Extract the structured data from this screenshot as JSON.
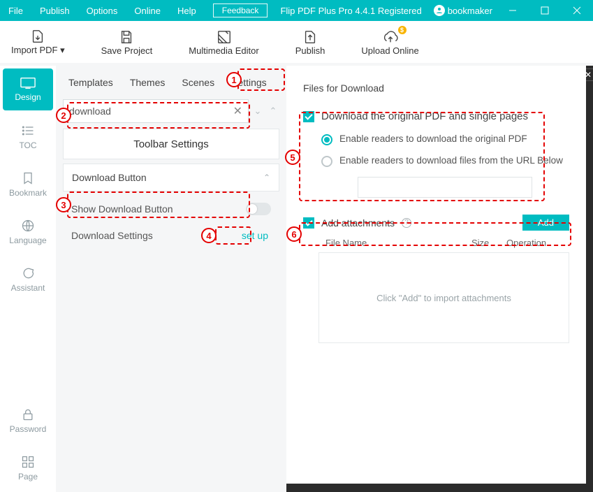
{
  "titlebar": {
    "menus": [
      "File",
      "Publish",
      "Options",
      "Online",
      "Help"
    ],
    "feedback": "Feedback",
    "app_title": "Flip PDF Plus Pro 4.4.1 Registered",
    "username": "bookmaker"
  },
  "toolbar": {
    "import": "Import PDF ▾",
    "save": "Save Project",
    "multimedia": "Multimedia Editor",
    "publish": "Publish",
    "upload": "Upload Online",
    "upload_badge": "$"
  },
  "sidebar": {
    "design": "Design",
    "toc": "TOC",
    "bookmark": "Bookmark",
    "language": "Language",
    "assistant": "Assistant",
    "password": "Password",
    "page": "Page"
  },
  "tabs": [
    "Templates",
    "Themes",
    "Scenes",
    "Settings"
  ],
  "search": {
    "value": "download"
  },
  "settings": {
    "section": "Toolbar Settings",
    "accordion": "Download Button",
    "show_download": "Show Download Button",
    "download_settings": "Download Settings",
    "setup": "set up"
  },
  "right": {
    "title": "Files for Download",
    "chk_download": "Download the original PDF and single pages",
    "radio_pdf": "Enable readers to download the original PDF",
    "radio_url": "Enable readers to download files from the URL Below",
    "chk_attach": "Add attachments",
    "add_btn": "Add",
    "col_file": "File Name",
    "col_size": "Size",
    "col_op": "Operation",
    "empty": "Click \"Add\" to import attachments"
  },
  "annotations": [
    "1",
    "2",
    "3",
    "4",
    "5",
    "6"
  ]
}
